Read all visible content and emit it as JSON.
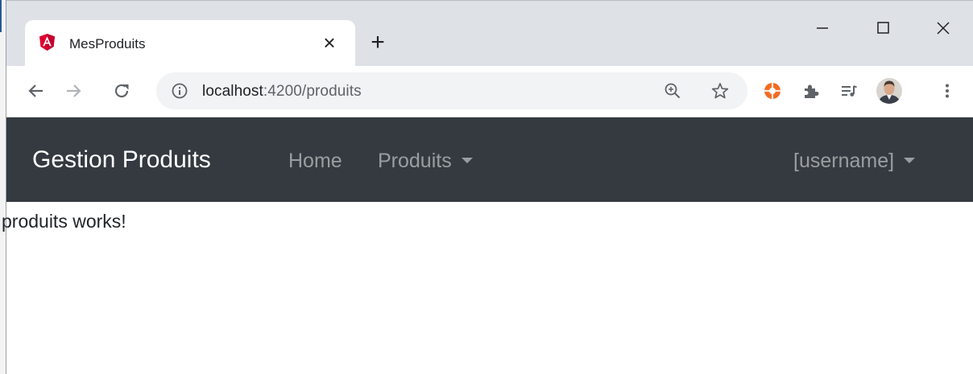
{
  "browser": {
    "tab": {
      "title": "MesProduits",
      "favicon": "angular-icon",
      "close": "×"
    },
    "new_tab": "+",
    "window_controls": {
      "minimize": "minimize-icon",
      "maximize": "maximize-icon",
      "close": "close-icon"
    },
    "toolbar": {
      "url_host": "localhost",
      "url_rest": ":4200/produits",
      "icons": [
        "back-arrow-icon",
        "forward-arrow-icon",
        "reload-icon",
        "info-icon",
        "zoom-icon",
        "star-icon",
        "extension-orange-icon",
        "puzzle-icon",
        "media-queue-icon",
        "profile-avatar",
        "menu-dots-icon"
      ]
    }
  },
  "navbar": {
    "brand": "Gestion Produits",
    "links": {
      "home": "Home",
      "produits": "Produits",
      "user": "[username]"
    },
    "background": "#343a40"
  },
  "content": {
    "message": "produits works!"
  }
}
